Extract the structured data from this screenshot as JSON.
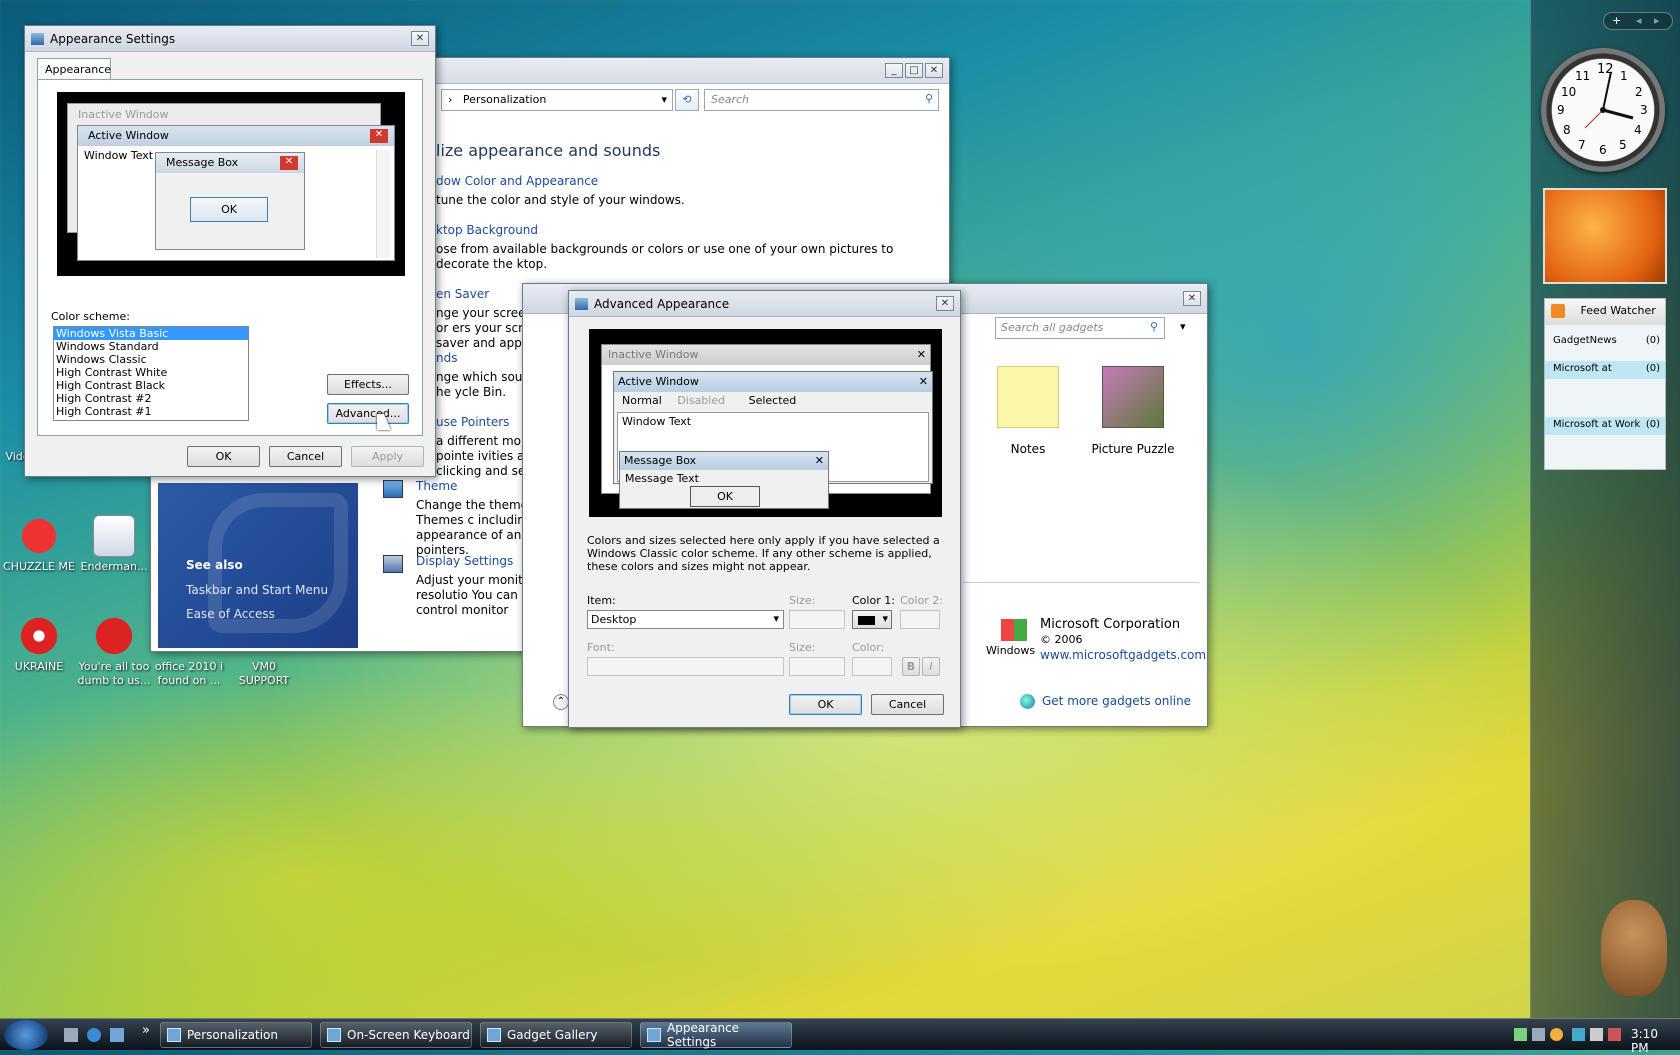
{
  "desktop_icons": [
    {
      "label": "Video Game"
    },
    {
      "label": "CHUZZLE ME"
    },
    {
      "label": "Enderman..."
    },
    {
      "label": "UKRAINE"
    },
    {
      "label": "You're all too dumb to us..."
    },
    {
      "label": "office 2010 i found on ..."
    },
    {
      "label": "VM0 SUPPORT"
    }
  ],
  "appearance": {
    "title": "Appearance Settings",
    "tab": "Appearance",
    "preview": {
      "inactive": "Inactive Window",
      "active": "Active Window",
      "window_text": "Window Text",
      "msgbox": "Message Box",
      "ok": "OK"
    },
    "scheme_label": "Color scheme:",
    "schemes": [
      "Windows Vista Basic",
      "Windows Standard",
      "Windows Classic",
      "High Contrast White",
      "High Contrast Black",
      "High Contrast #2",
      "High Contrast #1"
    ],
    "selected_scheme": "Windows Vista Basic",
    "effects": "Effects...",
    "advanced": "Advanced...",
    "ok": "OK",
    "cancel": "Cancel",
    "apply": "Apply"
  },
  "personalization": {
    "breadcrumb": "Personalization",
    "search_placeholder": "Search",
    "heading": "lize appearance and sounds",
    "items": [
      {
        "title": "dow Color and Appearance",
        "desc": " tune the color and style of your windows."
      },
      {
        "title": "ktop Background",
        "desc": "ose from available backgrounds or colors or use one of your own pictures to decorate the ktop."
      },
      {
        "title": "en Saver",
        "desc": "nge your screen saver or ers your screen saver and appea"
      },
      {
        "title": "nds",
        "desc": "nge which sounds are he ycle Bin."
      },
      {
        "title": "use Pointers",
        "desc": "a different mouse pointe ivities as clicking and selec"
      },
      {
        "title": "Theme",
        "desc": "Change the theme. Themes c including the appearance of and mouse pointers."
      },
      {
        "title": "Display Settings",
        "desc": "Adjust your monitor resolutio You can also control monitor"
      }
    ],
    "see_also": "See also",
    "see_also_links": [
      "Taskbar and Start Menu",
      "Ease of Access"
    ]
  },
  "advanced": {
    "title": "Advanced Appearance",
    "preview": {
      "inactive": "Inactive Window",
      "active": "Active Window",
      "menu": [
        "Normal",
        "Disabled",
        "Selected"
      ],
      "window_text": "Window Text",
      "msgbox": "Message Box",
      "msg_text": "Message Text",
      "ok": "OK"
    },
    "note": "Colors and sizes selected here only apply if you have selected a Windows Classic color scheme. If any other scheme is applied, these colors and sizes might not appear.",
    "item_label": "Item:",
    "item_value": "Desktop",
    "size_label": "Size:",
    "color1_label": "Color 1:",
    "color2_label": "Color 2:",
    "font_label": "Font:",
    "size2_label": "Size:",
    "color_label": "Color:",
    "bold": "B",
    "italic": "I",
    "ok": "OK",
    "cancel": "Cancel"
  },
  "gadgets": {
    "search_placeholder": "Search all gadgets",
    "items": [
      {
        "label": "Notes"
      },
      {
        "label": "Picture Puzzle"
      }
    ],
    "publisher": "Microsoft Corporation",
    "year": "© 2006",
    "windows_word": "Windows",
    "site": "www.microsoftgadgets.com",
    "get_more": "Get more gadgets online"
  },
  "sidebar": {
    "clock_numbers": [
      "12",
      "1",
      "2",
      "3",
      "4",
      "5",
      "6",
      "7",
      "8",
      "9",
      "10",
      "11"
    ],
    "feed_title": "Feed Watcher",
    "feeds": [
      {
        "name": "GadgetNews",
        "count": "(0)"
      },
      {
        "name": "Microsoft at",
        "count": "(0)"
      },
      {
        "name": "Microsoft at Work",
        "count": "(0)"
      }
    ]
  },
  "taskbar": {
    "items": [
      "Personalization",
      "On-Screen Keyboard",
      "Gadget Gallery",
      "Appearance Settings"
    ],
    "chevron": "»",
    "time": "3:10 PM"
  },
  "colors": {
    "accent": "#3399ff",
    "link": "#1a4b9c",
    "selection": "#3399ff"
  }
}
